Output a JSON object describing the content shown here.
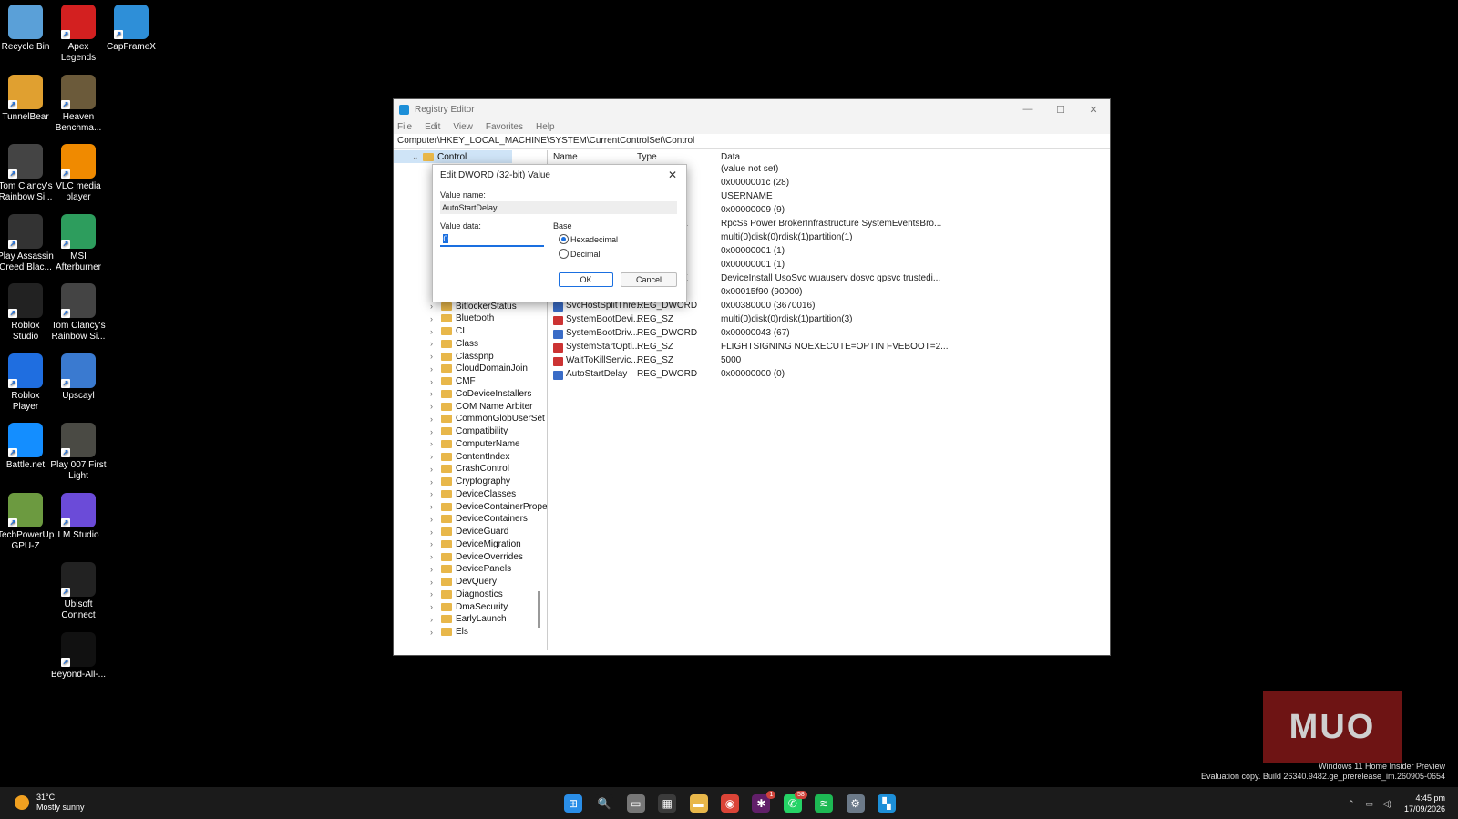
{
  "desktop_icons": [
    {
      "label": "Recycle Bin",
      "icon": "recycle-bin-icon",
      "color": "#5aa0d8"
    },
    {
      "label": "Apex Legends",
      "icon": "apex-legends-icon",
      "color": "#d32020"
    },
    {
      "label": "CapFrameX",
      "icon": "capframex-icon",
      "color": "#2e8fd8"
    },
    {
      "label": "TunnelBear",
      "icon": "tunnelbear-icon",
      "color": "#e0a030"
    },
    {
      "label": "Heaven Benchma...",
      "icon": "heaven-benchmark-icon",
      "color": "#6b5a3a"
    },
    {
      "label": "Tom Clancy's Rainbow Si...",
      "icon": "rainbow-six-icon",
      "color": "#444444"
    },
    {
      "label": "VLC media player",
      "icon": "vlc-icon",
      "color": "#f08a00"
    },
    {
      "label": "Play Assassin Creed Blac...",
      "icon": "assassins-creed-icon",
      "color": "#333333"
    },
    {
      "label": "MSI Afterburner",
      "icon": "msi-afterburner-icon",
      "color": "#2d9d5d"
    },
    {
      "label": "Roblox Studio",
      "icon": "roblox-studio-icon",
      "color": "#222222"
    },
    {
      "label": "Tom Clancy's Rainbow Si...",
      "icon": "rainbow-six-icon-2",
      "color": "#444444"
    },
    {
      "label": "Roblox Player",
      "icon": "roblox-player-icon",
      "color": "#1f6ee0"
    },
    {
      "label": "Upscayl",
      "icon": "upscayl-icon",
      "color": "#3a7ad0"
    },
    {
      "label": "Battle.net",
      "icon": "battlenet-icon",
      "color": "#148eff"
    },
    {
      "label": "Play 007 First Light",
      "icon": "007-first-light-icon",
      "color": "#4a4a44"
    },
    {
      "label": "TechPowerUp GPU-Z",
      "icon": "gpu-z-icon",
      "color": "#6c9a40"
    },
    {
      "label": "LM Studio",
      "icon": "lm-studio-icon",
      "color": "#6b4bd8"
    },
    {
      "label": "Ubisoft Connect",
      "icon": "ubisoft-connect-icon",
      "color": "#222222"
    },
    {
      "label": "Beyond-All-...",
      "icon": "beyond-all-reason-icon",
      "color": "#111111"
    }
  ],
  "window": {
    "title": "Registry Editor",
    "menu": [
      "File",
      "Edit",
      "View",
      "Favorites",
      "Help"
    ],
    "address": "Computer\\HKEY_LOCAL_MACHINE\\SYSTEM\\CurrentControlSet\\Control",
    "controls": {
      "minimize": "—",
      "maximize": "☐",
      "close": "✕"
    }
  },
  "tree": {
    "selected": "Control",
    "items": [
      "BitlockerStatus",
      "Bluetooth",
      "CI",
      "Class",
      "Classpnp",
      "CloudDomainJoin",
      "CMF",
      "CoDeviceInstallers",
      "COM Name Arbiter",
      "CommonGlobUserSet",
      "Compatibility",
      "ComputerName",
      "ContentIndex",
      "CrashControl",
      "Cryptography",
      "DeviceClasses",
      "DeviceContainerPrope",
      "DeviceContainers",
      "DeviceGuard",
      "DeviceMigration",
      "DeviceOverrides",
      "DevicePanels",
      "DevQuery",
      "Diagnostics",
      "DmaSecurity",
      "EarlyLaunch",
      "Els"
    ]
  },
  "list": {
    "headers": {
      "name": "Name",
      "type": "Type",
      "data": "Data"
    },
    "partial_rows": [
      {
        "type": "",
        "data": "(value not set)"
      },
      {
        "type": "D",
        "data": "0x0000001c (28)"
      },
      {
        "type": "",
        "data": "USERNAME"
      },
      {
        "type": "D",
        "data": "0x00000009 (9)"
      },
      {
        "type": "SZ",
        "data": "RpcSs Power BrokerInfrastructure SystemEventsBro..."
      },
      {
        "type": "",
        "data": "multi(0)disk(0)rdisk(1)partition(1)"
      },
      {
        "type": "D",
        "data": "0x00000001 (1)"
      },
      {
        "type": "D",
        "data": "0x00000001 (1)"
      },
      {
        "type": "SZ",
        "data": "DeviceInstall UsoSvc wuauserv dosvc gpsvc trustedi..."
      },
      {
        "type": "D",
        "data": "0x00015f90 (90000)"
      }
    ],
    "rows": [
      {
        "name": "SvcHostSplitThre...",
        "type": "REG_DWORD",
        "data": "0x00380000 (3670016)",
        "kind": "dw"
      },
      {
        "name": "SystemBootDevi...",
        "type": "REG_SZ",
        "data": "multi(0)disk(0)rdisk(1)partition(3)",
        "kind": "sz"
      },
      {
        "name": "SystemBootDriv...",
        "type": "REG_DWORD",
        "data": "0x00000043 (67)",
        "kind": "dw"
      },
      {
        "name": "SystemStartOpti...",
        "type": "REG_SZ",
        "data": " FLIGHTSIGNING  NOEXECUTE=OPTIN  FVEBOOT=2...",
        "kind": "sz"
      },
      {
        "name": "WaitToKillServic...",
        "type": "REG_SZ",
        "data": "5000",
        "kind": "sz"
      },
      {
        "name": "AutoStartDelay",
        "type": "REG_DWORD",
        "data": "0x00000000 (0)",
        "kind": "dw"
      }
    ]
  },
  "dialog": {
    "title": "Edit DWORD (32-bit) Value",
    "value_name_label": "Value name:",
    "value_name": "AutoStartDelay",
    "value_data_label": "Value data:",
    "value_data": "0",
    "base_label": "Base",
    "hex_label": "Hexadecimal",
    "dec_label": "Decimal",
    "selected_base": "Hexadecimal",
    "ok": "OK",
    "cancel": "Cancel",
    "close": "✕"
  },
  "taskbar": {
    "weather_temp": "31°C",
    "weather_desc": "Mostly sunny",
    "apps": [
      {
        "icon": "start-icon",
        "color": "#2a8ee8",
        "glyph": "⊞"
      },
      {
        "icon": "search-icon",
        "color": "#1b1b1b",
        "glyph": "🔍"
      },
      {
        "icon": "task-view-icon",
        "color": "#777777",
        "glyph": "▭"
      },
      {
        "icon": "store-icon",
        "color": "#3b3b3b",
        "glyph": "▦"
      },
      {
        "icon": "file-explorer-icon",
        "color": "#e8b74a",
        "glyph": "▬"
      },
      {
        "icon": "chrome-icon",
        "color": "#db4437",
        "glyph": "◉"
      },
      {
        "icon": "slack-icon",
        "color": "#611f69",
        "glyph": "✱",
        "badge": "1"
      },
      {
        "icon": "whatsapp-icon",
        "color": "#25d366",
        "glyph": "✆",
        "badge": "58"
      },
      {
        "icon": "spotify-icon",
        "color": "#1db954",
        "glyph": "≋"
      },
      {
        "icon": "settings-icon",
        "color": "#6c7a89",
        "glyph": "⚙"
      },
      {
        "icon": "registry-editor-icon",
        "color": "#1d8fd8",
        "glyph": "▚"
      }
    ],
    "time": "4:45 pm",
    "date": "17/09/2026"
  },
  "watermark": {
    "line1": "Windows 11 Home Insider Preview",
    "line2": "Evaluation copy. Build 26340.9482.ge_prerelease_im.260905-0654"
  },
  "logo": "MUO"
}
